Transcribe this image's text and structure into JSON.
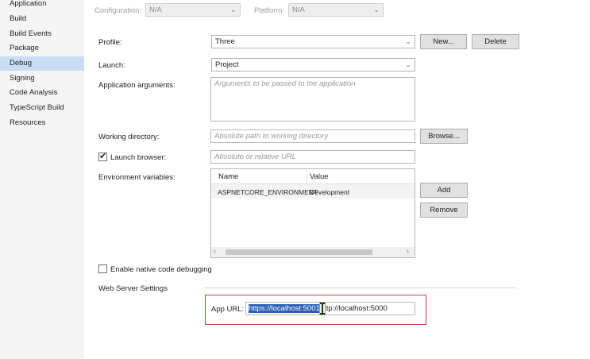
{
  "sidebar": {
    "items": [
      {
        "label": "Application"
      },
      {
        "label": "Build"
      },
      {
        "label": "Build Events"
      },
      {
        "label": "Package"
      },
      {
        "label": "Debug"
      },
      {
        "label": "Signing"
      },
      {
        "label": "Code Analysis"
      },
      {
        "label": "TypeScript Build"
      },
      {
        "label": "Resources"
      }
    ],
    "active": "Debug"
  },
  "topbar": {
    "configuration_label": "Configuration:",
    "configuration_value": "N/A",
    "platform_label": "Platform:",
    "platform_value": "N/A"
  },
  "profile": {
    "label": "Profile:",
    "value": "Three",
    "new_button": "New...",
    "delete_button": "Delete"
  },
  "launch": {
    "label": "Launch:",
    "value": "Project"
  },
  "app_args": {
    "label": "Application arguments:",
    "placeholder": "Arguments to be passed to the application"
  },
  "working_dir": {
    "label": "Working directory:",
    "placeholder": "Absolute path to working directory",
    "browse_button": "Browse..."
  },
  "launch_browser": {
    "label": "Launch browser:",
    "checked": true,
    "placeholder": "Absolute or relative URL"
  },
  "env": {
    "label": "Environment variables:",
    "columns": [
      "Name",
      "Value"
    ],
    "rows": [
      {
        "name": "ASPNETCORE_ENVIRONMENT",
        "value": "Development"
      }
    ],
    "add_button": "Add",
    "remove_button": "Remove"
  },
  "native_debug": {
    "label": "Enable native code debugging",
    "checked": false
  },
  "web_server": {
    "section_label": "Web Server Settings",
    "app_url_label": "App URL:",
    "app_url_selected": "https://localhost:5001",
    "app_url_rest": "http://localhost:5000"
  }
}
